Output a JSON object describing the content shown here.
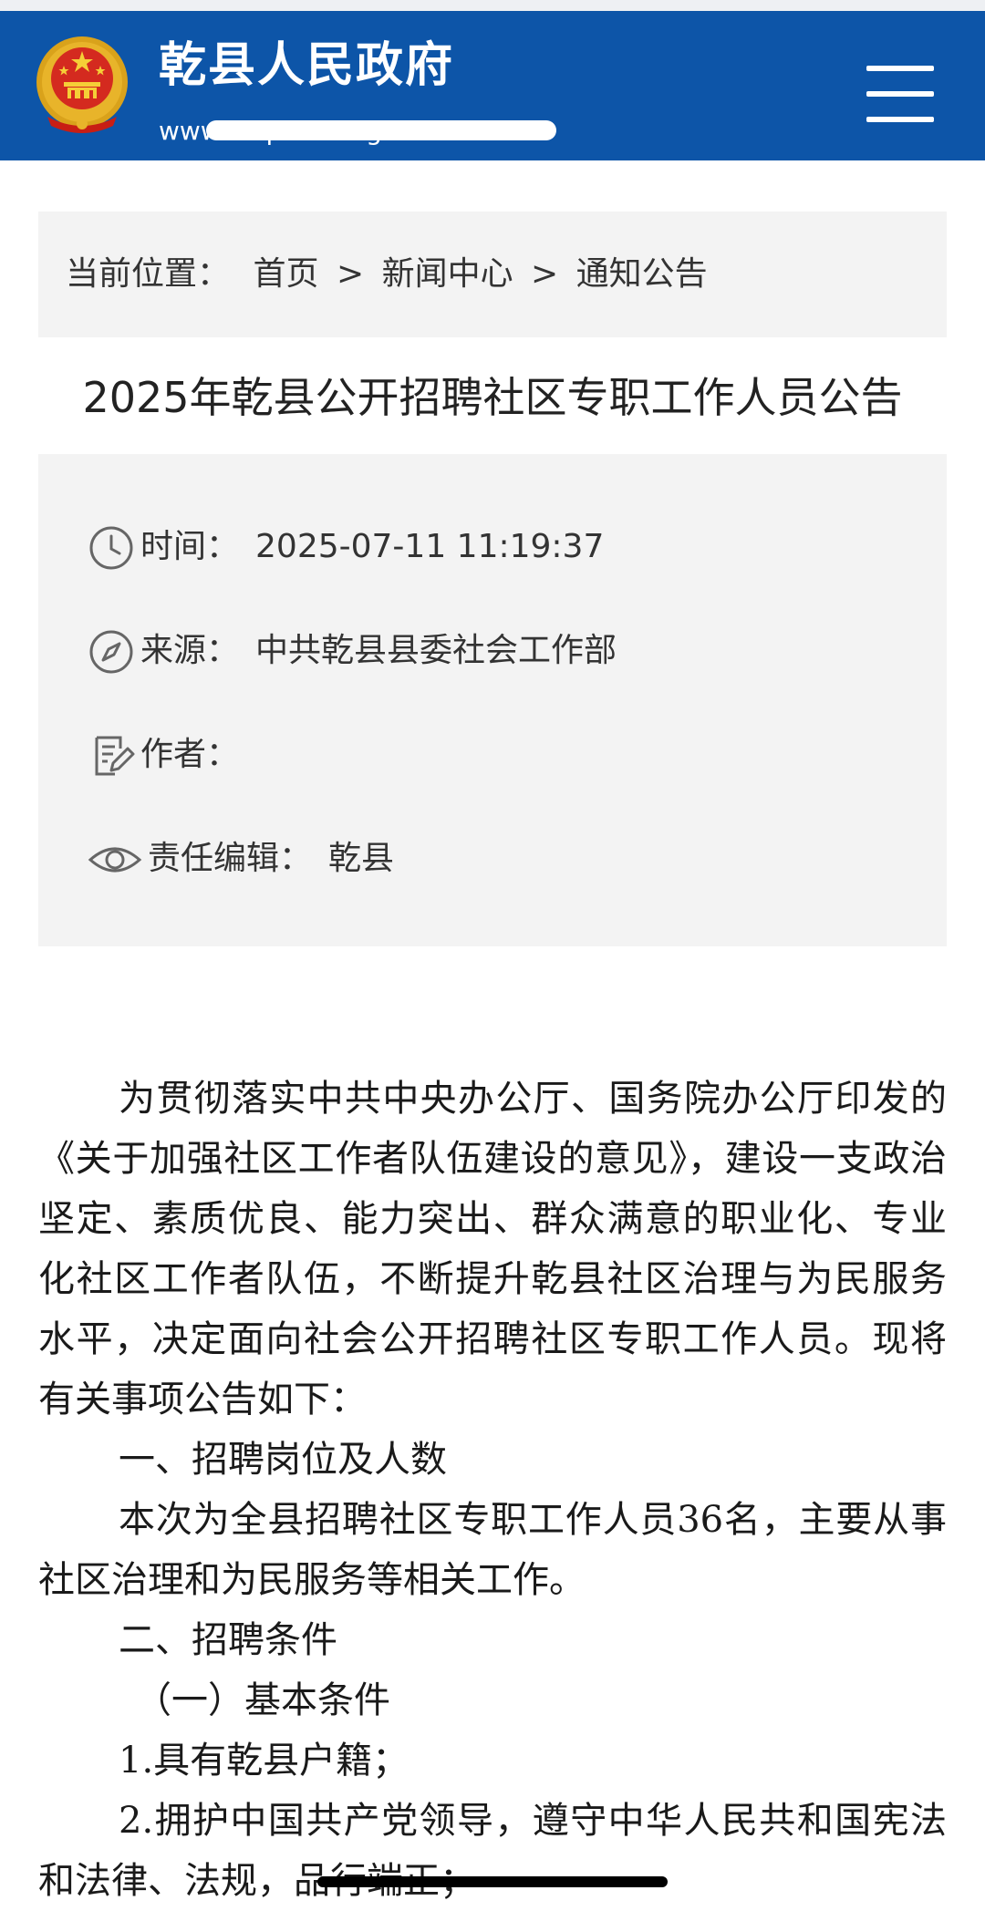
{
  "header": {
    "site_title": "乾县人民政府",
    "site_url": "www.shqianxiangov.cn",
    "emblem_icon": "national-emblem-icon",
    "menu_icon": "hamburger-menu-icon",
    "brand_color": "#0d55a8"
  },
  "breadcrumb": {
    "label": "当前位置：",
    "items": [
      "首页",
      "新闻中心",
      "通知公告"
    ],
    "separator": ">"
  },
  "article": {
    "title": "2025年乾县公开招聘社区专职工作人员公告",
    "meta": {
      "time_label": "时间：",
      "time_value": "2025-07-11 11:19:37",
      "source_label": "来源：",
      "source_value": "中共乾县县委社会工作部",
      "author_label": "作者：",
      "author_value": "",
      "editor_label": "责任编辑：",
      "editor_value": "乾县"
    },
    "paragraphs": [
      "为贯彻落实中共中央办公厅、国务院办公厅印发的《关于加强社区工作者队伍建设的意见》，建设一支政治坚定、素质优良、能力突出、群众满意的职业化、专业化社区工作者队伍，不断提升乾县社区治理与为民服务水平，决定面向社会公开招聘社区专职工作人员。现将有关事项公告如下：",
      "一、招聘岗位及人数",
      "本次为全县招聘社区专职工作人员36名，主要从事社区治理和为民服务等相关工作。",
      "二、招聘条件",
      "（一）基本条件",
      "1.具有乾县户籍；",
      "2.拥护中国共产党领导，遵守中华人民共和国宪法和法律、法规，品行端正；"
    ]
  }
}
